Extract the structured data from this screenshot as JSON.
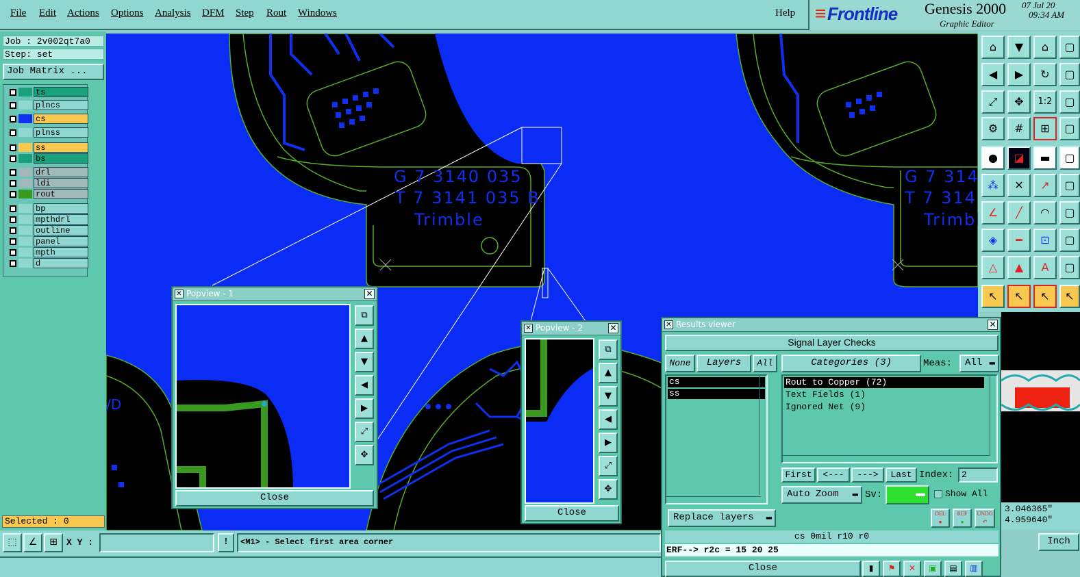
{
  "menubar": {
    "items": [
      "File",
      "Edit",
      "Actions",
      "Options",
      "Analysis",
      "DFM",
      "Step",
      "Rout",
      "Windows"
    ],
    "help": "Help"
  },
  "brand": {
    "logo": "Frontline",
    "product": "Genesis 2000",
    "subtitle": "Graphic Editor",
    "date": "07 Jul 20",
    "time": "09:34 AM"
  },
  "left": {
    "job": "Job : 2v002qt7a0",
    "step": "Step: set",
    "job_matrix": "Job Matrix ...",
    "layers": [
      {
        "name": "ts",
        "color": "#1aa07a",
        "bg": "#1aa07a"
      },
      {
        "name": "plncs",
        "color": "#8fd7d0",
        "bg": "#8fd7d0"
      },
      {
        "name": "cs",
        "color": "#1030f0",
        "bg": "#f8c850"
      },
      {
        "name": "plnss",
        "color": "#8fd7d0",
        "bg": "#8fd7d0"
      },
      {
        "name": "ss",
        "color": "#f8c850",
        "bg": "#f8c850"
      },
      {
        "name": "bs",
        "color": "#1aa07a",
        "bg": "#1aa07a"
      },
      {
        "name": "drl",
        "color": "#a0b8b8",
        "bg": "#a0b8b8"
      },
      {
        "name": "ldi",
        "color": "#a0b8b8",
        "bg": "#a0b8b8"
      },
      {
        "name": "rout",
        "color": "#3a9a20",
        "bg": "#a0b8b8"
      },
      {
        "name": "bp",
        "color": "#8fd7d0",
        "bg": "#8fd7d0"
      },
      {
        "name": "mpthdrl",
        "color": "#8fd7d0",
        "bg": "#8fd7d0"
      },
      {
        "name": "outline",
        "color": "#8fd7d0",
        "bg": "#8fd7d0"
      },
      {
        "name": "panel",
        "color": "#8fd7d0",
        "bg": "#8fd7d0"
      },
      {
        "name": "mpth",
        "color": "#8fd7d0",
        "bg": "#8fd7d0"
      },
      {
        "name": "d",
        "color": "#8fd7d0",
        "bg": "#8fd7d0"
      }
    ],
    "selected": "Selected : 0"
  },
  "canvas": {
    "silk_left": [
      "G 7 3140 035",
      "T 7 3141 035 B",
      "Trimble"
    ],
    "silk_right": [
      "G 7 3140",
      "T 7 3141",
      "Trimbl"
    ],
    "partial_text": "/D"
  },
  "popview1": {
    "title": "Popview - 1",
    "close": "Close"
  },
  "popview2": {
    "title": "Popview - 2",
    "close": "Close"
  },
  "results": {
    "title": "Results viewer",
    "header": "Signal Layer Checks",
    "none": "None",
    "layers_label": "Layers",
    "all": "All",
    "categories": "Categories (3)",
    "meas_label": "Meas:",
    "meas_value": "All",
    "layer_items": [
      "cs",
      "ss"
    ],
    "category_items": [
      "Rout to Copper (72)",
      "Text Fields (1)",
      "Ignored Net (9)"
    ],
    "first": "First",
    "prev": "<---",
    "next": "--->",
    "last": "Last",
    "index_label": "Index:",
    "index_value": "2",
    "auto_zoom": "Auto Zoom",
    "sv_label": "Sv:",
    "show_all": "Show All",
    "replace_layers": "Replace layers",
    "del": "DEL",
    "ref": "REF",
    "undo": "UNDO",
    "status1": "cs 0mil  r10  r0",
    "status2": "ERF--> r2c = 15 20 25",
    "close": "Close"
  },
  "coords": {
    "x": "3.046365\"",
    "y": "4.959640\"",
    "unit": "Inch"
  },
  "bottom": {
    "xy_label": "X Y :",
    "xy_value": "",
    "prompt": "<M1> - Select first area corner",
    "warn": "!"
  }
}
